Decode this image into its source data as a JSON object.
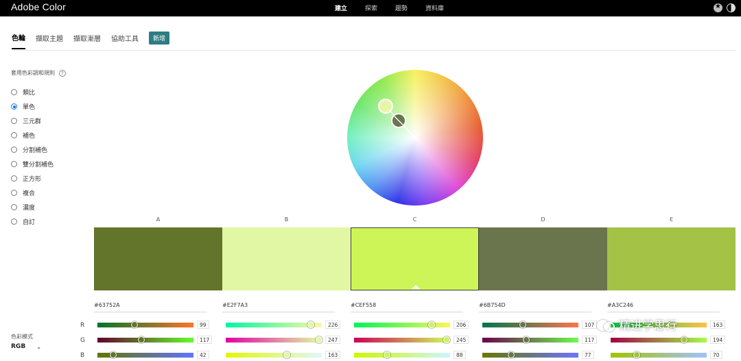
{
  "app": {
    "title": "Adobe Color"
  },
  "nav": {
    "items": [
      "建立",
      "探索",
      "趨勢",
      "資料庫"
    ]
  },
  "tabs": {
    "items": [
      "色輪",
      "擷取主題",
      "擷取漸層",
      "協助工具"
    ],
    "badge": "新增"
  },
  "sidebar": {
    "title": "套用色彩調和規則",
    "help": "?",
    "rules": [
      "類比",
      "單色",
      "三元群",
      "補色",
      "分割補色",
      "雙分割補色",
      "正方形",
      "複合",
      "濃度",
      "自訂"
    ],
    "selected_rule": "單色",
    "mode_label": "色彩模式",
    "mode_value": "RGB"
  },
  "swatches": [
    {
      "label": "A",
      "hex": "#63752A",
      "color": "#63752A",
      "rgb": [
        99,
        117,
        42
      ]
    },
    {
      "label": "B",
      "hex": "#E2F7A3",
      "color": "#E2F7A3",
      "rgb": [
        226,
        247,
        163
      ]
    },
    {
      "label": "C",
      "hex": "#CEF558",
      "color": "#CEF558",
      "rgb": [
        206,
        245,
        88
      ]
    },
    {
      "label": "D",
      "hex": "#6B754D",
      "color": "#6B754D",
      "rgb": [
        107,
        117,
        77
      ]
    },
    {
      "label": "E",
      "hex": "#A3C246",
      "color": "#A3C246",
      "rgb": [
        163,
        194,
        70
      ]
    }
  ],
  "channels": [
    "R",
    "G",
    "B"
  ],
  "selected_swatch": "C",
  "watermark": {
    "text": "精进学思行"
  }
}
